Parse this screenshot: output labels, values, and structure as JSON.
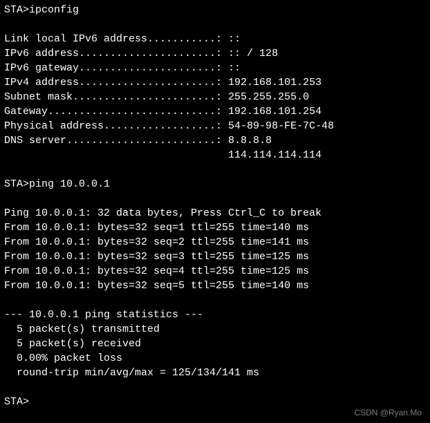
{
  "cmd1": {
    "prompt": "STA>",
    "command": "ipconfig"
  },
  "ipconfig": {
    "line1": "Link local IPv6 address...........: ::",
    "line2": "IPv6 address......................: :: / 128",
    "line3": "IPv6 gateway......................: ::",
    "line4": "IPv4 address......................: 192.168.101.253",
    "line5": "Subnet mask.......................: 255.255.255.0",
    "line6": "Gateway...........................: 192.168.101.254",
    "line7": "Physical address..................: 54-89-98-FE-7C-48",
    "line8": "DNS server........................: 8.8.8.8",
    "line9": "                                    114.114.114.114"
  },
  "cmd2": {
    "prompt": "STA>",
    "command": "ping 10.0.0.1"
  },
  "ping": {
    "header": "Ping 10.0.0.1: 32 data bytes, Press Ctrl_C to break",
    "reply1": "From 10.0.0.1: bytes=32 seq=1 ttl=255 time=140 ms",
    "reply2": "From 10.0.0.1: bytes=32 seq=2 ttl=255 time=141 ms",
    "reply3": "From 10.0.0.1: bytes=32 seq=3 ttl=255 time=125 ms",
    "reply4": "From 10.0.0.1: bytes=32 seq=4 ttl=255 time=125 ms",
    "reply5": "From 10.0.0.1: bytes=32 seq=5 ttl=255 time=140 ms",
    "stats_header": "--- 10.0.0.1 ping statistics ---",
    "stats_tx": "  5 packet(s) transmitted",
    "stats_rx": "  5 packet(s) received",
    "stats_loss": "  0.00% packet loss",
    "stats_rtt": "  round-trip min/avg/max = 125/134/141 ms"
  },
  "cmd3": {
    "prompt": "STA>"
  },
  "watermark": "CSDN @Ryan.Mo"
}
